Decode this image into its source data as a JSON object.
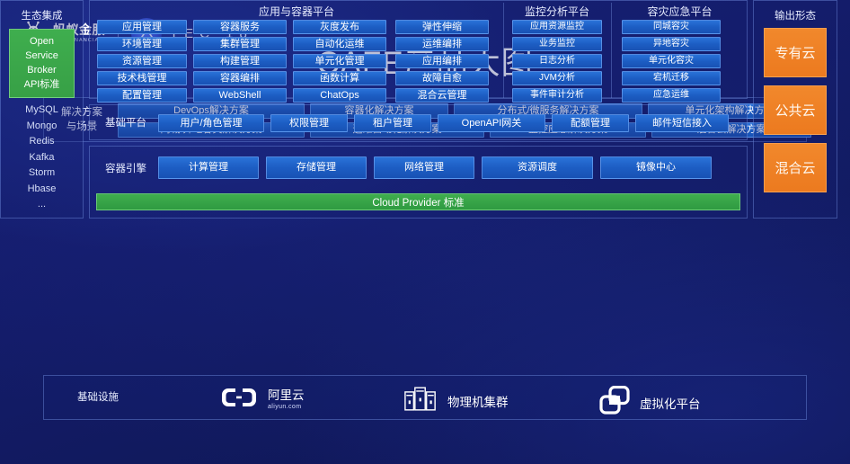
{
  "header": {
    "brand_cn": "蚂蚁金服",
    "brand_en": "ANT FINANCIAL",
    "event": "TEC 18",
    "ant_icon": "ant-mascot-icon",
    "atec_icon": "atec-circle-icon"
  },
  "title": "CAFE产品大图",
  "solutions": {
    "label": "解决方案\n与场景",
    "label_line1": "解决方案",
    "label_line2": "与场景",
    "row1": [
      "DevOps解决方案",
      "容器化解决方案",
      "分布式/微服务解决方案",
      "单元化架构解决方案"
    ],
    "row2": [
      "同城/异地容灾解决方案",
      "运维自动化解决方案",
      "监控应急解决方案",
      "混合云解决方案"
    ]
  },
  "ecosystem": {
    "title": "生态集成",
    "highlight": [
      "Open",
      "Service",
      "Broker",
      "API标准"
    ],
    "items": [
      "MySQL",
      "Mongo",
      "Redis",
      "Kafka",
      "Storm",
      "Hbase",
      "..."
    ],
    "highlight_color": "#3fae4e"
  },
  "platforms": [
    {
      "title": "应用与容器平台",
      "columns": [
        [
          "应用管理",
          "环境管理",
          "资源管理",
          "技术栈管理",
          "配置管理"
        ],
        [
          "容器服务",
          "集群管理",
          "构建管理",
          "容器编排",
          "WebShell"
        ],
        [
          "灰度发布",
          "自动化运维",
          "单元化管理",
          "函数计算",
          "ChatOps"
        ],
        [
          "弹性伸缩",
          "运维编排",
          "应用编排",
          "故障自愈",
          "混合云管理"
        ]
      ]
    },
    {
      "title": "监控分析平台",
      "columns": [
        [
          "应用资源监控",
          "业务监控",
          "日志分析",
          "JVM分析",
          "事件审计分析"
        ]
      ]
    },
    {
      "title": "容灾应急平台",
      "columns": [
        [
          "同城容灾",
          "异地容灾",
          "单元化容灾",
          "宕机迁移",
          "应急运维"
        ]
      ]
    }
  ],
  "basic_platform": {
    "label": "基础平台",
    "items": [
      "用户/角色管理",
      "权限管理",
      "租户管理",
      "OpenAPI网关",
      "配额管理",
      "邮件短信接入"
    ]
  },
  "container_engine": {
    "label": "容器引擎",
    "items": [
      "计算管理",
      "存储管理",
      "网络管理",
      "资源调度",
      "镜像中心"
    ],
    "cloud_provider_bar": "Cloud Provider 标准",
    "cloud_provider_color": "#3fae4e"
  },
  "output": {
    "title": "输出形态",
    "cards": [
      "专有云",
      "公共云",
      "混合云"
    ],
    "card_color": "#ee7d22"
  },
  "infrastructure": {
    "label": "基础设施",
    "items": [
      {
        "icon": "aliyun-logo-icon",
        "label": "阿里云",
        "sublabel": "aliyun.com"
      },
      {
        "icon": "server-rack-icon",
        "label": "物理机集群"
      },
      {
        "icon": "vmware-squares-icon",
        "label": "虚拟化平台"
      }
    ]
  },
  "colors": {
    "background": "#141c6b",
    "chip_blue": "#1d5ec4",
    "accent_green": "#3fae4e",
    "accent_orange": "#ee7d22"
  }
}
